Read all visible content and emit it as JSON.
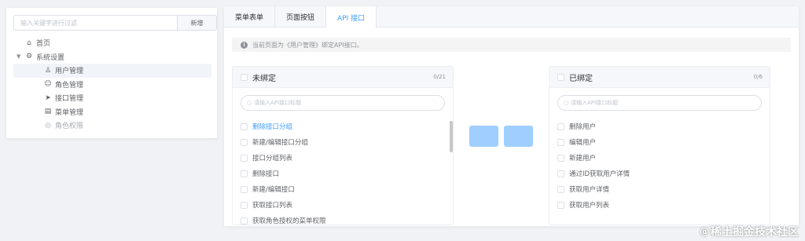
{
  "tree_panel": {
    "search_placeholder": "输入关键字进行过滤",
    "add_label": "新增",
    "nodes": [
      {
        "label": "首页",
        "icon": "home-icon",
        "glyph": "⌂"
      },
      {
        "label": "系统设置",
        "icon": "gear-icon",
        "glyph": "⚙"
      },
      {
        "label": "用户管理",
        "icon": "user-icon",
        "glyph": "♙"
      },
      {
        "label": "角色管理",
        "icon": "role-icon",
        "glyph": "☺"
      },
      {
        "label": "接口管理",
        "icon": "send-icon",
        "glyph": "➤"
      },
      {
        "label": "菜单管理",
        "icon": "menu-icon",
        "glyph": "▤"
      },
      {
        "label": "角色权限",
        "icon": "permission-icon",
        "glyph": "◎"
      }
    ]
  },
  "tabs": [
    {
      "label": "菜单表单"
    },
    {
      "label": "页面按钮"
    },
    {
      "label": "API 接口"
    }
  ],
  "alert": {
    "icon": "info-icon",
    "text": "当前页面为《用户管理》绑定API接口。"
  },
  "left_transfer": {
    "title": "未绑定",
    "count": "0/21",
    "filter_placeholder": "请输入API接口标题",
    "items": [
      "删除接口分组",
      "新建/编辑接口分组",
      "接口分组列表",
      "删除接口",
      "新建/编辑接口",
      "获取接口列表",
      "获取角色授权的菜单权限"
    ]
  },
  "right_transfer": {
    "title": "已绑定",
    "count": "0/6",
    "filter_placeholder": "请输入API接口标题",
    "items": [
      "删除用户",
      "编辑用户",
      "新建用户",
      "通过ID获取用户详情",
      "获取用户详情",
      "获取用户列表"
    ]
  },
  "watermark": {
    "text": "稀土掘金技术社区"
  },
  "colors": {
    "accent": "#409eff",
    "button_disabled": "#a0cfff"
  }
}
